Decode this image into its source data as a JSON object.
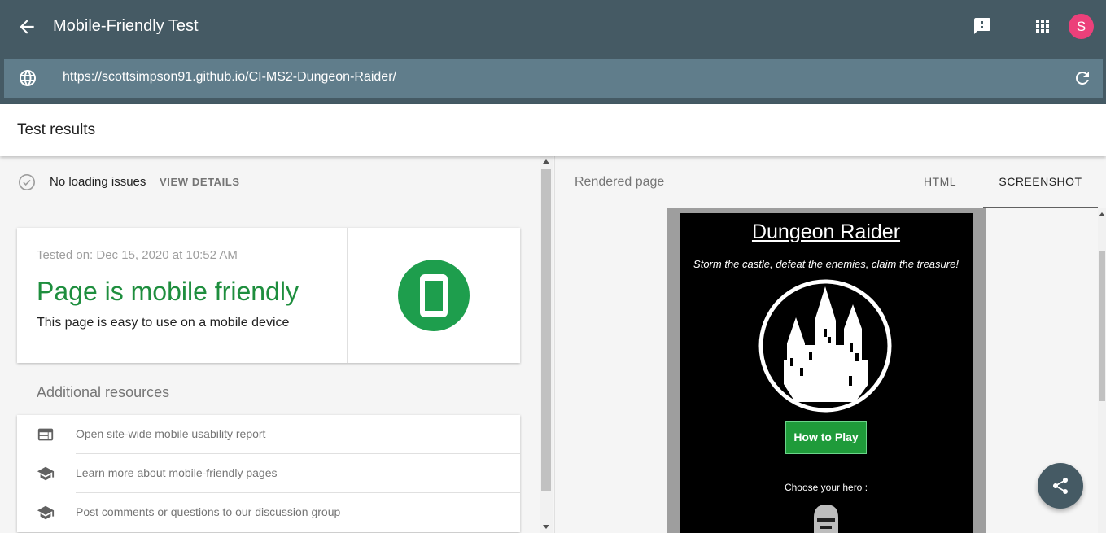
{
  "header": {
    "title": "Mobile-Friendly Test",
    "avatar_initial": "S",
    "url": "https://scottsimpson91.github.io/CI-MS2-Dungeon-Raider/"
  },
  "results": {
    "title": "Test results",
    "status_text": "No loading issues",
    "view_details_label": "VIEW DETAILS",
    "tested_on": "Tested on: Dec 15, 2020 at 10:52 AM",
    "verdict": "Page is mobile friendly",
    "verdict_sub": "This page is easy to use on a mobile device"
  },
  "resources": {
    "title": "Additional resources",
    "items": [
      {
        "label": "Open site-wide mobile usability report",
        "icon": "report-icon"
      },
      {
        "label": "Learn more about mobile-friendly pages",
        "icon": "school-icon"
      },
      {
        "label": "Post comments or questions to our discussion group",
        "icon": "school-icon"
      }
    ]
  },
  "rendered": {
    "label": "Rendered page",
    "tabs": [
      {
        "label": "HTML",
        "selected": false
      },
      {
        "label": "SCREENSHOT",
        "selected": true
      }
    ],
    "screenshot": {
      "title": "Dungeon Raider",
      "tagline": "Storm the castle, defeat the enemies, claim the treasure!",
      "button_label": "How to Play",
      "choose_label": "Choose your hero :"
    }
  },
  "colors": {
    "header_bg": "#455a64",
    "url_bar_bg": "#607d8b",
    "success_green": "#1e8e3e",
    "avatar_pink": "#ec407a",
    "game_button_green": "#1f9b3a"
  }
}
